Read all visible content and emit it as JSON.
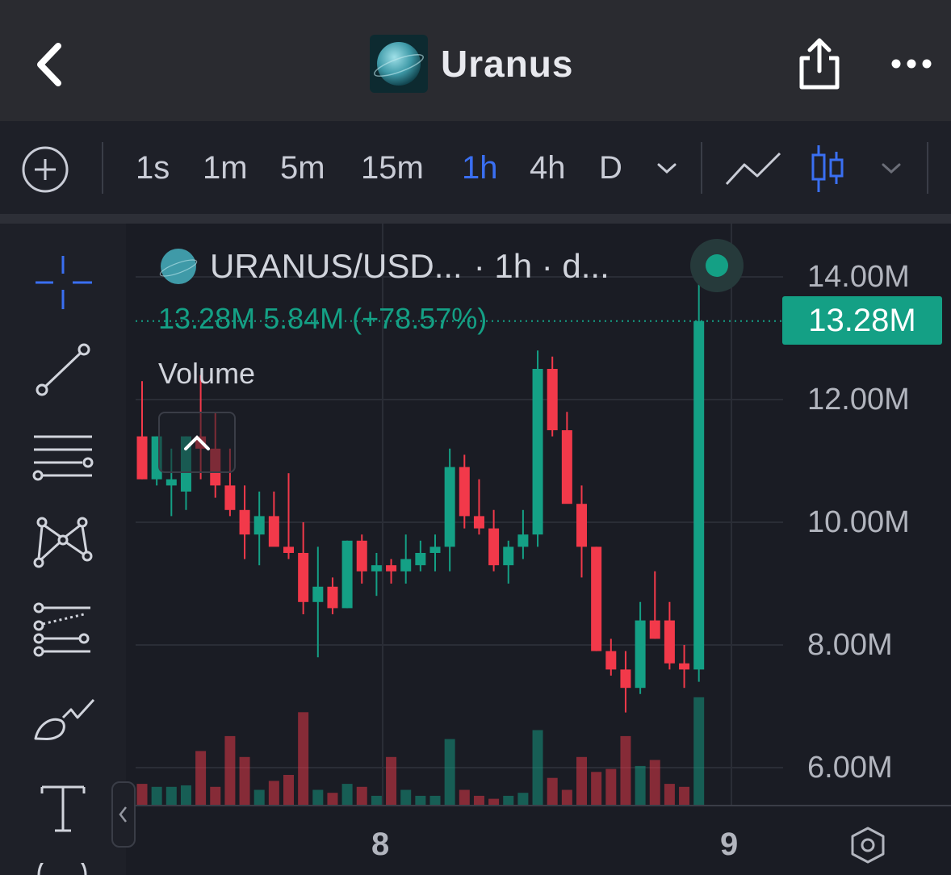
{
  "header": {
    "title": "Uranus",
    "icons": [
      "back-arrow-icon",
      "planet-logo-icon",
      "share-icon",
      "more-icon"
    ]
  },
  "toolbar": {
    "timeframes": [
      "1s",
      "1m",
      "5m",
      "15m",
      "1h",
      "4h",
      "D"
    ],
    "active_timeframe": "1h",
    "icons": [
      "add-indicator-icon",
      "chevron-down-icon",
      "line-chart-icon",
      "candlestick-icon",
      "chevron-down-icon"
    ]
  },
  "left_tools": [
    "crosshair-icon",
    "trend-line-icon",
    "fib-lines-icon",
    "pattern-icon",
    "forecast-icon",
    "brush-icon",
    "text-icon"
  ],
  "legend": {
    "symbol": "URANUS/USD...",
    "interval": "· 1h · d...",
    "ohlc_text": "13.28M  5.84M  (+78.57%)",
    "volume_label": "Volume"
  },
  "price_tag": "13.28M",
  "colors": {
    "up": "#14a085",
    "down": "#f2394a",
    "accent": "#3a6ff2",
    "background": "#1a1c24"
  },
  "chart_data": {
    "type": "candlestick",
    "title": "",
    "y_axis": {
      "ticks": [
        "14.00M",
        "12.00M",
        "10.00M",
        "8.00M",
        "6.00M"
      ],
      "ylim": [
        5.6,
        14.5
      ],
      "unit": "M"
    },
    "x_axis": {
      "ticks": [
        "8",
        "9"
      ]
    },
    "last_price": 13.28,
    "candles": [
      {
        "o": 11.4,
        "h": 12.3,
        "l": 10.7,
        "c": 10.7
      },
      {
        "o": 10.7,
        "h": 11.4,
        "l": 10.6,
        "c": 11.4
      },
      {
        "o": 10.6,
        "h": 11.2,
        "l": 10.1,
        "c": 10.7
      },
      {
        "o": 10.5,
        "h": 11.4,
        "l": 10.2,
        "c": 11.4
      },
      {
        "o": 11.4,
        "h": 12.4,
        "l": 10.7,
        "c": 11.2
      },
      {
        "o": 11.2,
        "h": 11.8,
        "l": 10.4,
        "c": 10.6
      },
      {
        "o": 10.6,
        "h": 11.2,
        "l": 10.1,
        "c": 10.2
      },
      {
        "o": 10.2,
        "h": 10.6,
        "l": 9.4,
        "c": 9.8
      },
      {
        "o": 9.8,
        "h": 10.5,
        "l": 9.3,
        "c": 10.1
      },
      {
        "o": 10.1,
        "h": 10.5,
        "l": 9.7,
        "c": 9.6
      },
      {
        "o": 9.6,
        "h": 10.8,
        "l": 9.4,
        "c": 9.5
      },
      {
        "o": 9.5,
        "h": 10.0,
        "l": 8.5,
        "c": 8.7
      },
      {
        "o": 8.7,
        "h": 9.6,
        "l": 7.8,
        "c": 8.95
      },
      {
        "o": 8.95,
        "h": 9.1,
        "l": 8.5,
        "c": 8.6
      },
      {
        "o": 8.6,
        "h": 9.7,
        "l": 8.6,
        "c": 9.7
      },
      {
        "o": 9.7,
        "h": 9.8,
        "l": 9.0,
        "c": 9.2
      },
      {
        "o": 9.2,
        "h": 9.5,
        "l": 8.8,
        "c": 9.3
      },
      {
        "o": 9.3,
        "h": 9.4,
        "l": 9.0,
        "c": 9.2
      },
      {
        "o": 9.2,
        "h": 9.8,
        "l": 9.0,
        "c": 9.4
      },
      {
        "o": 9.3,
        "h": 9.7,
        "l": 9.2,
        "c": 9.5
      },
      {
        "o": 9.5,
        "h": 9.8,
        "l": 9.2,
        "c": 9.6
      },
      {
        "o": 9.6,
        "h": 11.2,
        "l": 9.2,
        "c": 10.9
      },
      {
        "o": 10.9,
        "h": 11.1,
        "l": 9.9,
        "c": 10.1
      },
      {
        "o": 10.1,
        "h": 10.7,
        "l": 9.8,
        "c": 9.9
      },
      {
        "o": 9.9,
        "h": 10.2,
        "l": 9.2,
        "c": 9.3
      },
      {
        "o": 9.3,
        "h": 9.7,
        "l": 9.0,
        "c": 9.6
      },
      {
        "o": 9.6,
        "h": 10.2,
        "l": 9.4,
        "c": 9.8
      },
      {
        "o": 9.8,
        "h": 12.8,
        "l": 9.6,
        "c": 12.5
      },
      {
        "o": 12.5,
        "h": 12.7,
        "l": 11.4,
        "c": 11.5
      },
      {
        "o": 11.5,
        "h": 11.8,
        "l": 10.4,
        "c": 10.3
      },
      {
        "o": 10.3,
        "h": 10.6,
        "l": 9.1,
        "c": 9.6
      },
      {
        "o": 9.6,
        "h": 9.6,
        "l": 7.9,
        "c": 7.9
      },
      {
        "o": 7.9,
        "h": 8.1,
        "l": 7.5,
        "c": 7.6
      },
      {
        "o": 7.6,
        "h": 7.9,
        "l": 6.9,
        "c": 7.3
      },
      {
        "o": 7.3,
        "h": 8.7,
        "l": 7.2,
        "c": 8.4
      },
      {
        "o": 8.4,
        "h": 9.2,
        "l": 8.1,
        "c": 8.1
      },
      {
        "o": 8.4,
        "h": 8.7,
        "l": 7.6,
        "c": 7.7
      },
      {
        "o": 7.7,
        "h": 8.0,
        "l": 7.3,
        "c": 7.6
      },
      {
        "o": 7.6,
        "h": 14.3,
        "l": 7.4,
        "c": 13.28
      }
    ],
    "volume": [
      0.7,
      0.6,
      0.6,
      0.65,
      1.8,
      0.6,
      2.3,
      1.6,
      0.5,
      0.8,
      1.0,
      3.1,
      0.5,
      0.4,
      0.7,
      0.6,
      0.3,
      1.6,
      0.5,
      0.3,
      0.3,
      2.2,
      0.5,
      0.3,
      0.2,
      0.3,
      0.4,
      2.5,
      0.9,
      0.5,
      1.6,
      1.1,
      1.2,
      2.3,
      1.3,
      1.5,
      0.7,
      0.6,
      3.6
    ]
  }
}
